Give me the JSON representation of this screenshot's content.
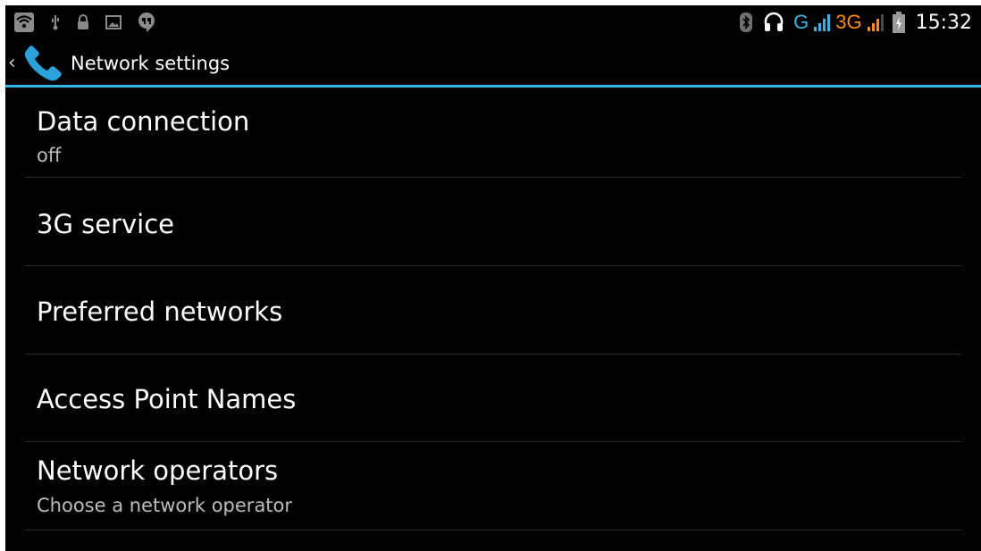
{
  "status_bar": {
    "left_icons": [
      "wifi-icon",
      "usb-icon",
      "lock-icon",
      "image-icon",
      "hangouts-icon"
    ],
    "right_icons": [
      "bluetooth-icon",
      "headset-icon",
      "signal-icon",
      "signal-icon",
      "battery-icon"
    ],
    "network_g": "G",
    "network_3g": "3G",
    "time": "15:32",
    "colors": {
      "g": "#33b5e5",
      "threeg": "#ff8a00",
      "signal_orange": "#ff8a00"
    }
  },
  "action_bar": {
    "up_caret": "‹",
    "app_icon": "phone-icon",
    "title": "Network settings",
    "accent_color": "#33b5e5"
  },
  "settings": {
    "items": [
      {
        "title": "Data connection",
        "summary": "off"
      },
      {
        "title": "3G service"
      },
      {
        "title": "Preferred networks"
      },
      {
        "title": "Access Point Names"
      },
      {
        "title": "Network operators",
        "summary": "Choose a network operator"
      }
    ]
  }
}
